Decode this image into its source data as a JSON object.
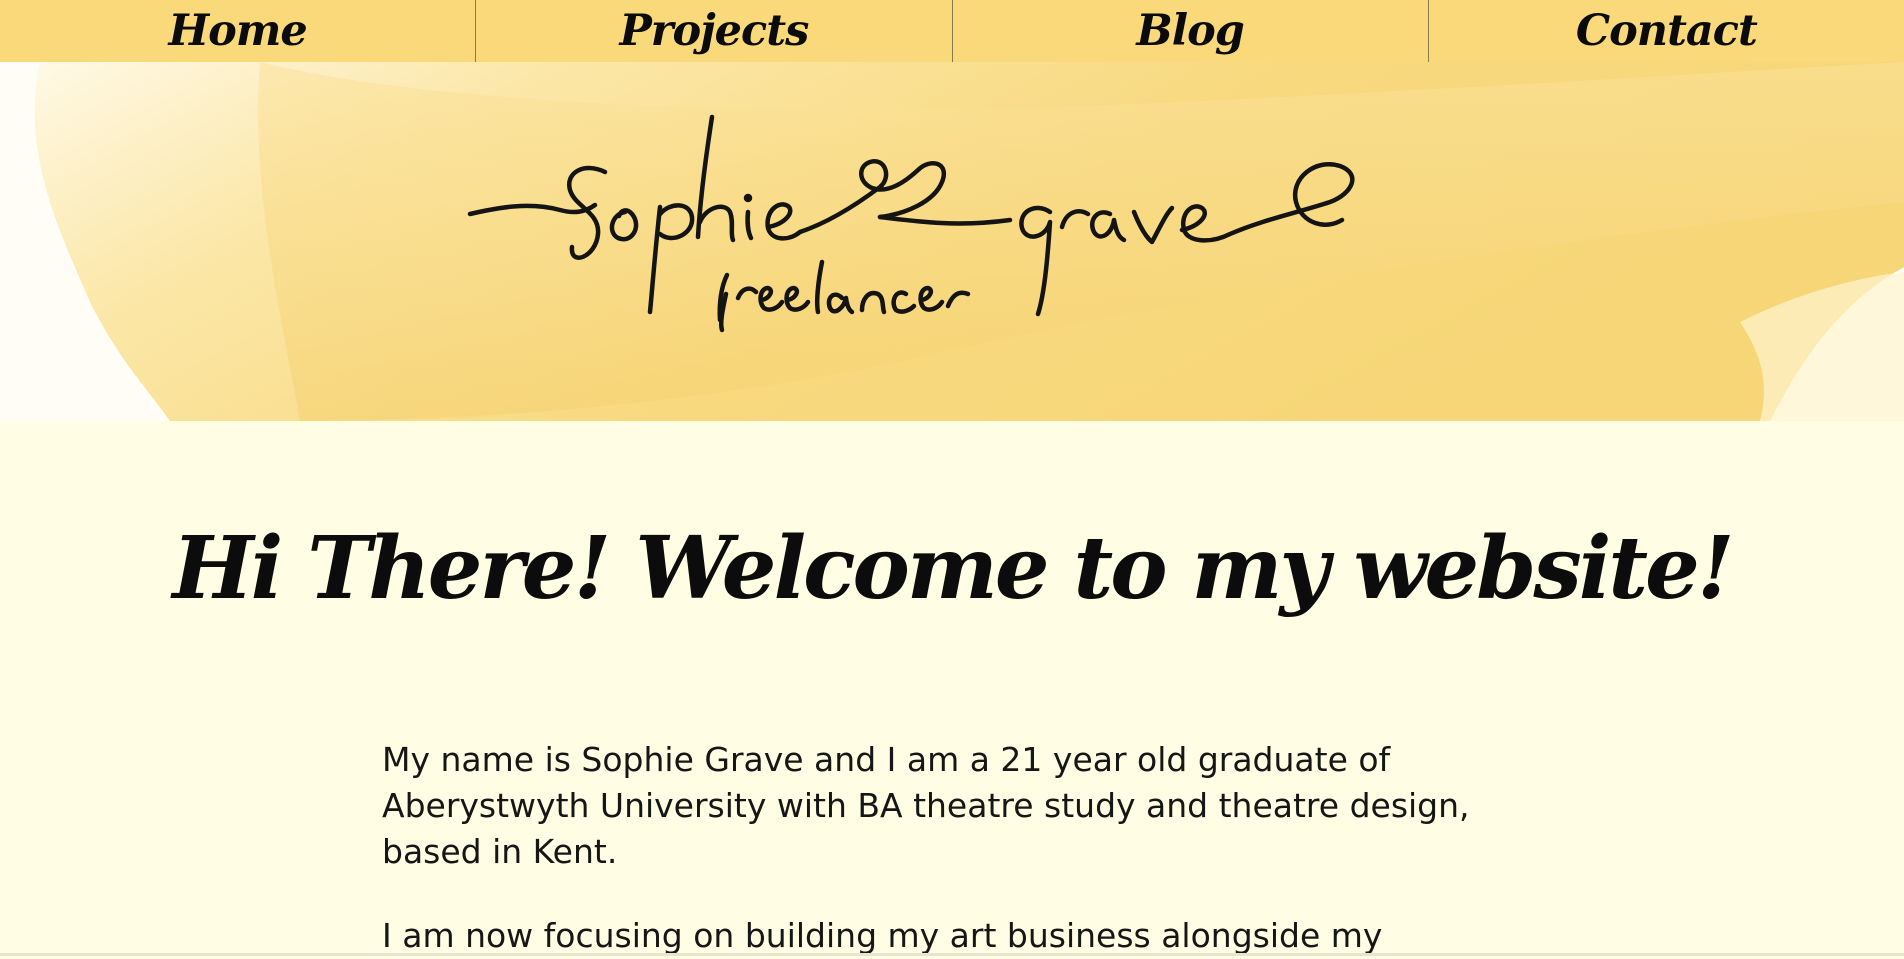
{
  "nav": {
    "items": [
      {
        "label": "Home"
      },
      {
        "label": "Projects"
      },
      {
        "label": "Blog"
      },
      {
        "label": "Contact"
      }
    ],
    "background": "#f9d97a"
  },
  "banner": {
    "logo_name": "Sophie Grave",
    "logo_tagline": "freelancer",
    "accent_color": "#f6d374"
  },
  "main": {
    "welcome_heading": "Hi There! Welcome to my website!",
    "paragraphs": [
      "My name is Sophie Grave and I am a 21 year old graduate of Aberystwyth University with BA theatre study and theatre design, based in Kent.",
      "I am now focusing on building my art business alongside my"
    ],
    "background": "#fffde3"
  }
}
